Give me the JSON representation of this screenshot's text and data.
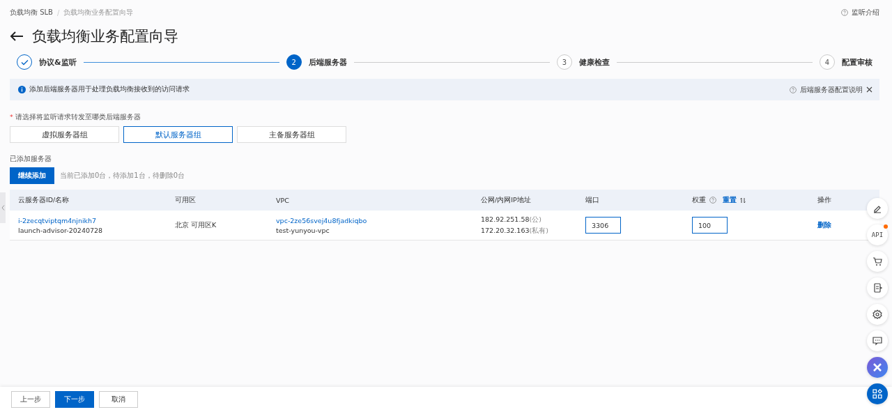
{
  "breadcrumb": [
    {
      "label": "负载均衡 SLB",
      "current": false
    },
    {
      "label": "负载均衡业务配置向导",
      "current": true
    }
  ],
  "help_link": "监听介绍",
  "title": "负载均衡业务配置向导",
  "breadcrumb_separator": "/",
  "steps": [
    {
      "label": "协议&监听",
      "completed": true,
      "current": false
    },
    {
      "label": "后端服务器",
      "number": "2",
      "completed": false,
      "current": true
    },
    {
      "label": "健康检查",
      "number": "3",
      "completed": false,
      "current": false
    },
    {
      "label": "配置审核",
      "number": "4",
      "completed": false,
      "current": false
    }
  ],
  "alert": {
    "message": "添加后端服务器用于处理负载均衡接收到的访问请求",
    "help": "后端服务器配置说明"
  },
  "group_prompt": {
    "required_mark": "*",
    "label": "请选择将监听请求转发至哪类后端服务器"
  },
  "group_types": [
    {
      "label": "虚拟服务器组",
      "selected": false
    },
    {
      "label": "默认服务器组",
      "selected": true
    },
    {
      "label": "主备服务器组",
      "selected": false
    }
  ],
  "added_section": {
    "title": "已添加服务器",
    "add_button": "继续添加",
    "summary": "当前已添加0台，待添加1台，待删除0台"
  },
  "table": {
    "columns": [
      {
        "label": "云服务器ID/名称"
      },
      {
        "label": "可用区"
      },
      {
        "label": "VPC"
      },
      {
        "label": "公网/内网IP地址"
      },
      {
        "label": "端口"
      },
      {
        "label": "权重",
        "help": true,
        "action": "重置",
        "sortable": true
      },
      {
        "label": "操作"
      }
    ],
    "rows": [
      {
        "instance_id": "i-2zecqtviptqm4njnikh7",
        "instance_name": "launch-advisor-20240728",
        "zone": "北京 可用区K",
        "vpc_id": "vpc-2ze56svej4u8fjadkiqbo",
        "vpc_name": "test-yunyou-vpc",
        "public_ip": "182.92.251.58",
        "public_tag": "(公)",
        "private_ip": "172.20.32.163",
        "private_tag": "(私有)",
        "port": "3306",
        "weight": "100",
        "action": "删除"
      }
    ]
  },
  "side_tools": [
    {
      "kind": "edit"
    },
    {
      "kind": "api",
      "label": "API",
      "badge": true
    },
    {
      "kind": "cart"
    },
    {
      "kind": "app"
    },
    {
      "kind": "settings"
    },
    {
      "kind": "chat"
    },
    {
      "kind": "close"
    },
    {
      "kind": "apps"
    }
  ],
  "footer_buttons": [
    {
      "label": "上一步",
      "kind": "default"
    },
    {
      "label": "下一步",
      "kind": "primary"
    },
    {
      "label": "取消",
      "kind": "default"
    }
  ]
}
